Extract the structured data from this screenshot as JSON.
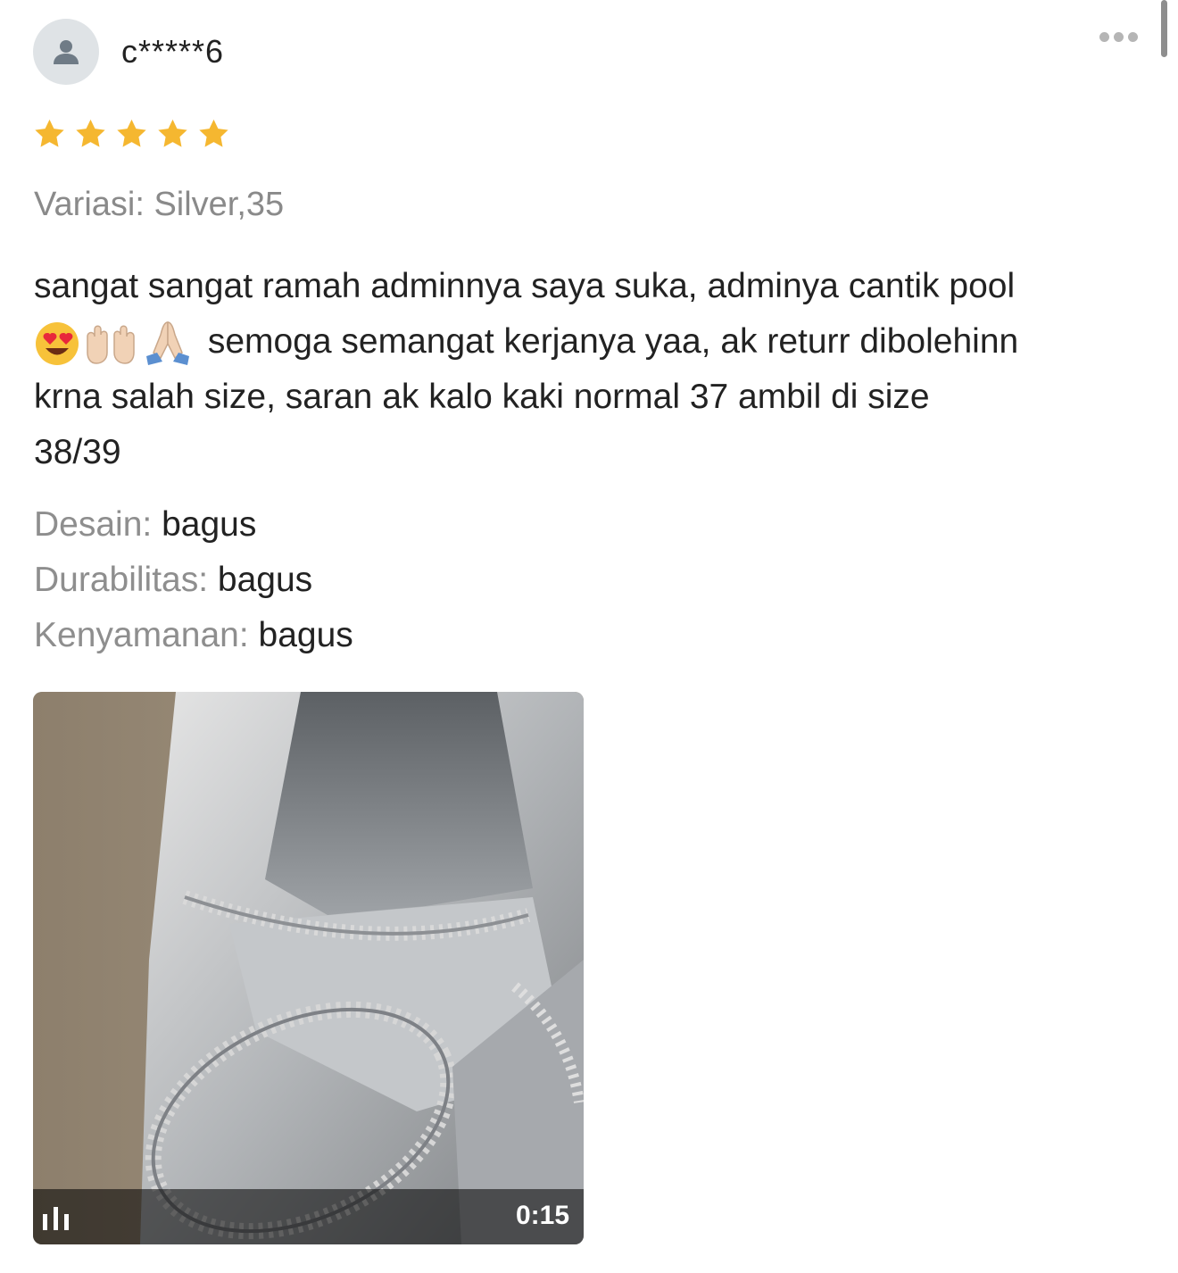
{
  "reviewer": {
    "name": "c*****6",
    "avatar_icon": "user-icon"
  },
  "more_icon": "more-dots-icon",
  "rating": {
    "value": 5,
    "max": 5,
    "star_color": "#f5b730"
  },
  "variation": "Variasi: Silver,35",
  "comment": {
    "line1": "sangat sangat ramah adminnya saya suka, adminya cantik pool",
    "line2_emojis": [
      "heart-eyes-emoji",
      "open-hands-emoji",
      "folded-hands-emoji"
    ],
    "line2": "semoga semangat kerjanya yaa, ak returr dibolehinn",
    "line3": "krna salah size, saran ak kalo kaki normal 37 ambil di size",
    "line4": "38/39"
  },
  "attributes": [
    {
      "key": "Desain:",
      "value": "bagus"
    },
    {
      "key": "Durabilitas:",
      "value": "bagus"
    },
    {
      "key": "Kenyamanan:",
      "value": "bagus"
    }
  ],
  "media": {
    "type": "video",
    "description_icon": "video-icon",
    "duration": "0:15"
  }
}
